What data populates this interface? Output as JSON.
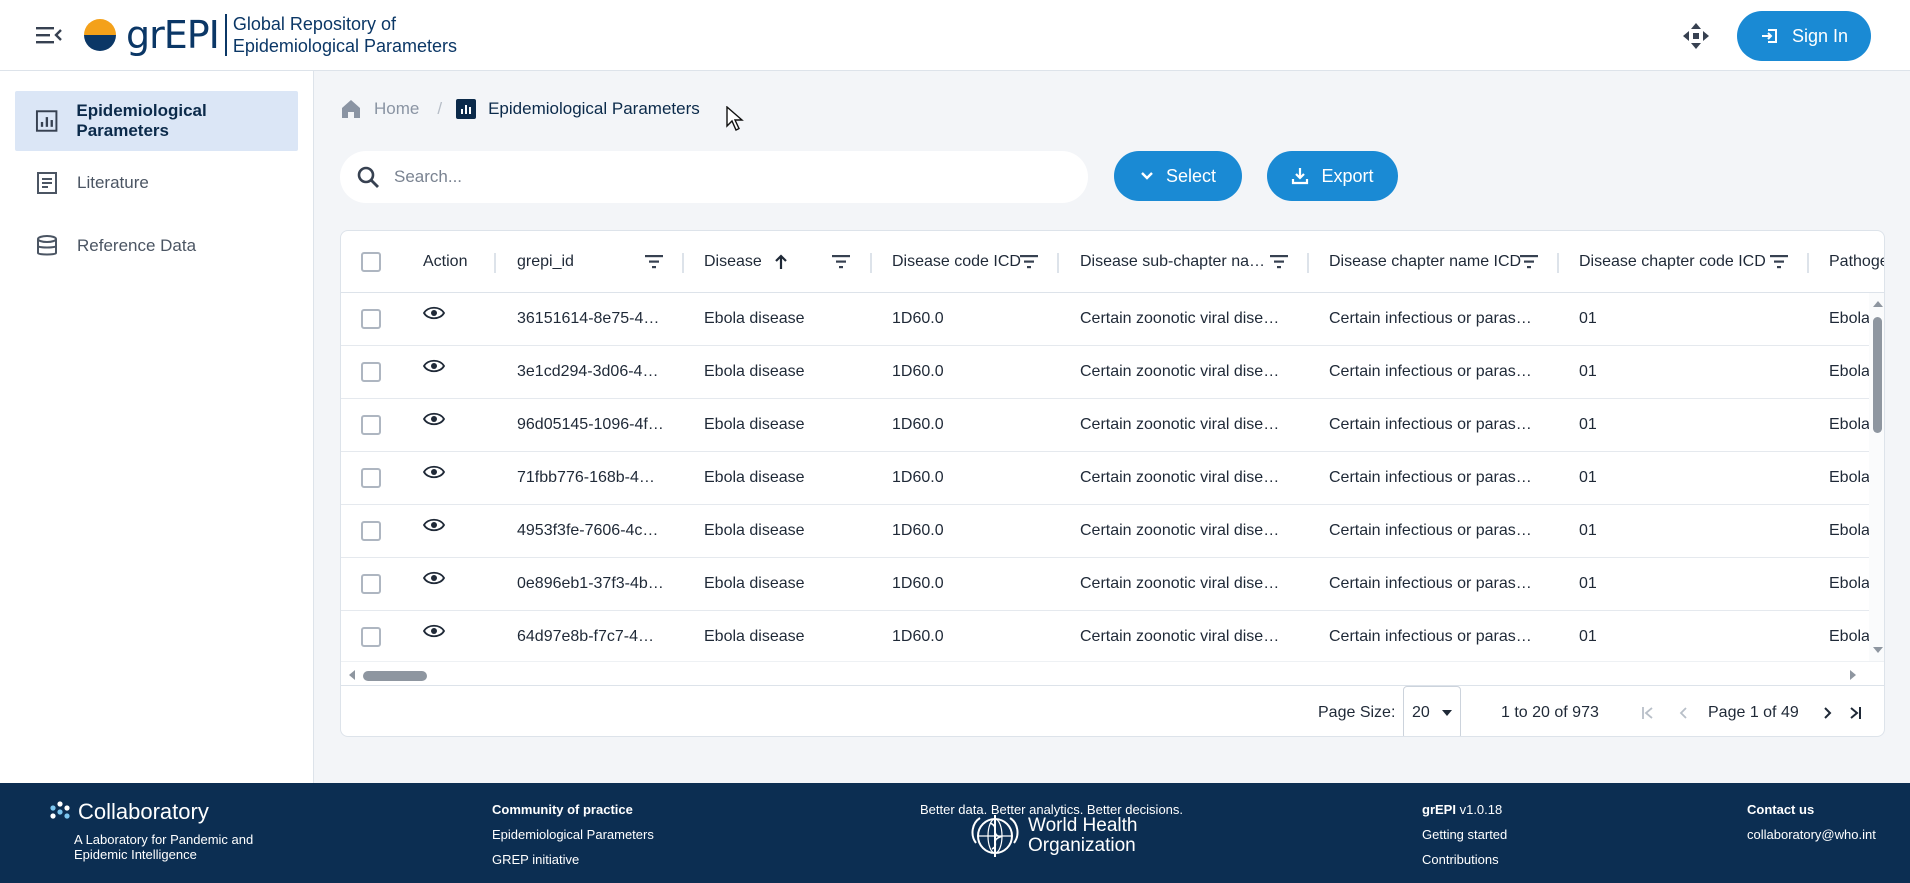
{
  "header": {
    "logo_text": "grEPI",
    "subtitle_line1": "Global Repository of",
    "subtitle_line2": "Epidemiological Parameters",
    "sign_in_label": "Sign In"
  },
  "sidebar": {
    "items": [
      {
        "label": "Epidemiological Parameters",
        "icon": "chart-icon",
        "active": true
      },
      {
        "label": "Literature",
        "icon": "document-icon",
        "active": false
      },
      {
        "label": "Reference Data",
        "icon": "database-icon",
        "active": false
      }
    ]
  },
  "breadcrumb": {
    "home": "Home",
    "separator": "/",
    "current": "Epidemiological Parameters"
  },
  "search": {
    "placeholder": "Search..."
  },
  "toolbar": {
    "select_label": "Select",
    "export_label": "Export"
  },
  "table": {
    "columns": [
      "Action",
      "grepi_id",
      "Disease",
      "Disease code ICD",
      "Disease sub-chapter na…",
      "Disease chapter name ICD",
      "Disease chapter code ICD",
      "Pathoge"
    ],
    "sorted_column": "Disease",
    "sort_direction": "ascending",
    "rows": [
      {
        "grepi_id": "36151614-8e75-4…",
        "disease": "Ebola disease",
        "icd": "1D60.0",
        "subchapter": "Certain zoonotic viral dise…",
        "chapter": "Certain infectious or paras…",
        "chapter_code": "01",
        "pathogen": "Ebola"
      },
      {
        "grepi_id": "3e1cd294-3d06-4…",
        "disease": "Ebola disease",
        "icd": "1D60.0",
        "subchapter": "Certain zoonotic viral dise…",
        "chapter": "Certain infectious or paras…",
        "chapter_code": "01",
        "pathogen": "Ebola"
      },
      {
        "grepi_id": "96d05145-1096-4f…",
        "disease": "Ebola disease",
        "icd": "1D60.0",
        "subchapter": "Certain zoonotic viral dise…",
        "chapter": "Certain infectious or paras…",
        "chapter_code": "01",
        "pathogen": "Ebola"
      },
      {
        "grepi_id": "71fbb776-168b-4…",
        "disease": "Ebola disease",
        "icd": "1D60.0",
        "subchapter": "Certain zoonotic viral dise…",
        "chapter": "Certain infectious or paras…",
        "chapter_code": "01",
        "pathogen": "Ebola"
      },
      {
        "grepi_id": "4953f3fe-7606-4c…",
        "disease": "Ebola disease",
        "icd": "1D60.0",
        "subchapter": "Certain zoonotic viral dise…",
        "chapter": "Certain infectious or paras…",
        "chapter_code": "01",
        "pathogen": "Ebola"
      },
      {
        "grepi_id": "0e896eb1-37f3-4b…",
        "disease": "Ebola disease",
        "icd": "1D60.0",
        "subchapter": "Certain zoonotic viral dise…",
        "chapter": "Certain infectious or paras…",
        "chapter_code": "01",
        "pathogen": "Ebola"
      },
      {
        "grepi_id": "64d97e8b-f7c7-4…",
        "disease": "Ebola disease",
        "icd": "1D60.0",
        "subchapter": "Certain zoonotic viral dise…",
        "chapter": "Certain infectious or paras…",
        "chapter_code": "01",
        "pathogen": "Ebola"
      }
    ]
  },
  "pagination": {
    "page_size_label": "Page Size:",
    "page_size": "20",
    "range": "1 to 20 of 973",
    "page_info": "Page 1 of 49"
  },
  "footer": {
    "collab_name": "Collaboratory",
    "collab_tag1": "A Laboratory for Pandemic and",
    "collab_tag2": "Epidemic Intelligence",
    "community_title": "Community of practice",
    "community_link1": "Epidemiological Parameters",
    "community_link2": "GREP initiative",
    "tagline": "Better data. Better analytics. Better decisions.",
    "who_line1": "World Health",
    "who_line2": "Organization",
    "app_name": "grEPI",
    "app_version": "v1.0.18",
    "app_link1": "Getting started",
    "app_link2": "Contributions",
    "contact_title": "Contact us",
    "contact_email": "collaboratory@who.int"
  },
  "colors": {
    "brand_navy": "#0b3766",
    "accent_blue": "#1a8ad4",
    "logo_orange": "#f4a11a",
    "footer_bg": "#0c2e52",
    "active_nav_bg": "#dbe6f6"
  }
}
